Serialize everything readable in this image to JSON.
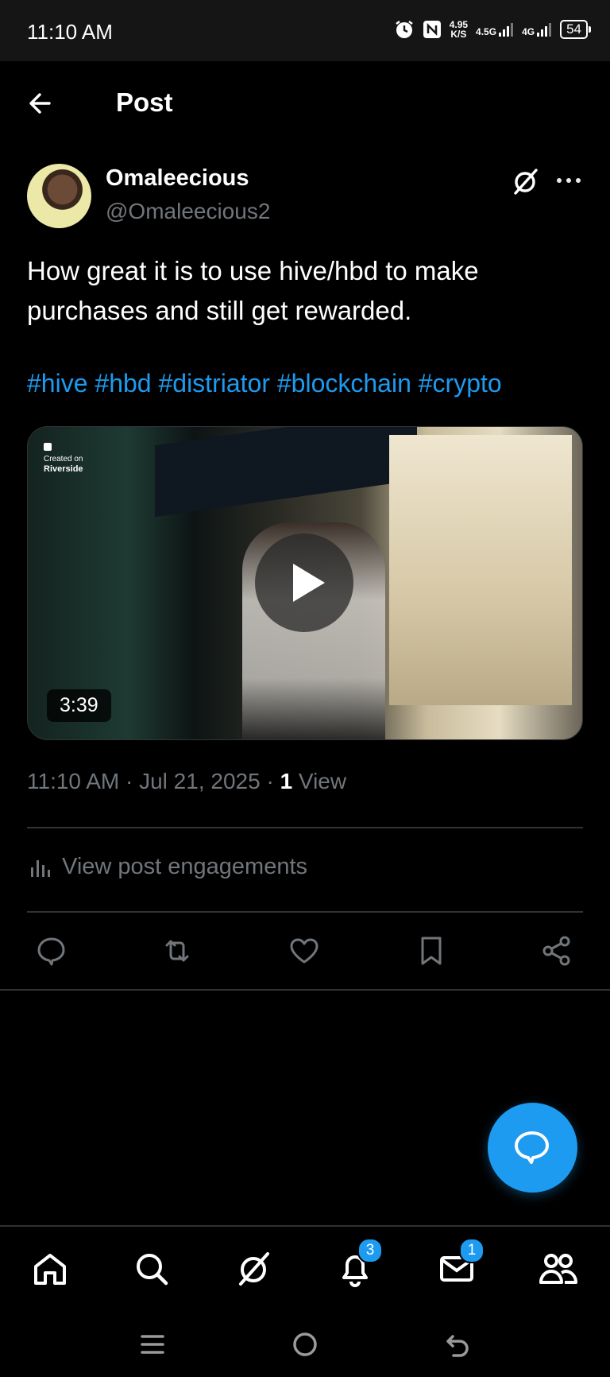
{
  "status_bar": {
    "time": "11:10 AM",
    "net_speed_value": "4.95",
    "net_speed_unit": "K/S",
    "signal_1": "4.5G",
    "signal_2": "4G",
    "battery": "54",
    "icons": [
      "alarm-icon",
      "nfc-icon"
    ]
  },
  "header": {
    "title": "Post",
    "back_icon": "arrow-left-icon"
  },
  "post": {
    "author_name": "Omaleecious",
    "author_handle": "@Omaleecious2",
    "text": "How great it is to use hive/hbd to make purchases and still get rewarded.",
    "hashtags": [
      "#hive",
      "#hbd",
      "#distriator",
      "#blockchain",
      "#crypto"
    ],
    "video": {
      "watermark_line1": "Created on",
      "watermark_line2": "Riverside",
      "duration": "3:39"
    },
    "timestamp": "11:10 AM · Jul 21, 2025 · ",
    "views_count": "1",
    "views_label": " View",
    "engagements_label": "View post engagements"
  },
  "actions": [
    "reply-icon",
    "repost-icon",
    "like-icon",
    "bookmark-icon",
    "share-icon"
  ],
  "bottom_nav": {
    "items": [
      "home-icon",
      "search-icon",
      "grok-icon",
      "notifications-icon",
      "messages-icon",
      "communities-icon"
    ],
    "notifications_badge": "3",
    "messages_badge": "1"
  },
  "colors": {
    "accent": "#1d9bf0",
    "background": "#000000",
    "secondary_text": "#71767b"
  }
}
